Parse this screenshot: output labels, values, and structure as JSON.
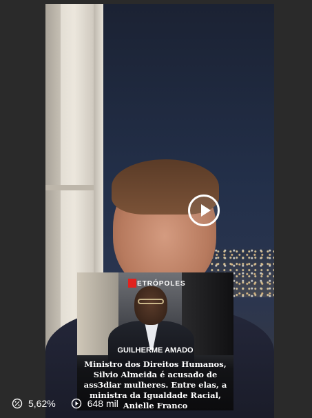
{
  "video": {
    "play_label": "Play"
  },
  "news_card": {
    "brand": "ETRÓPOLES",
    "author": "GUILHERME AMADO",
    "headline": "Ministro dos Direitos Humanos, Silvio Almeida é acusado de ass3diar mulheres. Entre elas, a ministra da Igualdade Racial, Anielle Franco"
  },
  "stats": {
    "engagement_rate": "5,62%",
    "views": "648 mil"
  },
  "icons": {
    "engagement": "percent-circle-icon",
    "views": "play-circle-icon",
    "play": "play-icon"
  },
  "colors": {
    "brand_red": "#e0221e",
    "background": "#2a2a2a"
  }
}
